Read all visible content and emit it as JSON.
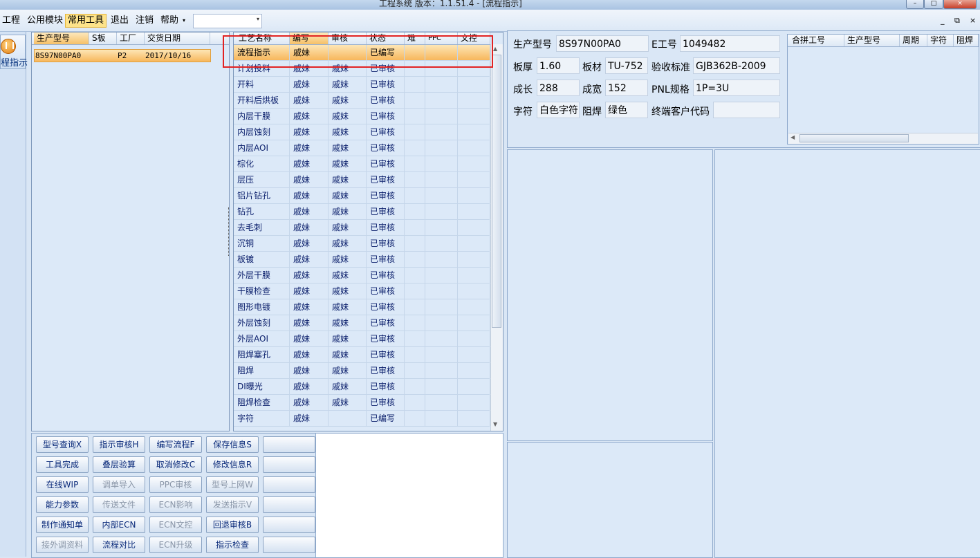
{
  "window": {
    "title": "工程系统   版本：1.1.51.4 - [流程指示]",
    "controls": [
      "–",
      "□",
      "×"
    ],
    "mdi_controls": [
      "_",
      "⧉",
      "×"
    ]
  },
  "menu": {
    "items": [
      "工程",
      "公用模块",
      "常用工具",
      "退出",
      "注销",
      "帮助"
    ],
    "active_index": 2,
    "help_arrow": "▾",
    "combo_arrow": "▾"
  },
  "sidebar": {
    "button_label": "程指示",
    "icon": "flow-indicator-icon"
  },
  "model_list": {
    "columns": [
      "生产型号",
      "S板",
      "工厂",
      "交货日期"
    ],
    "rows": [
      {
        "model": "8S97N00PA0",
        "s_board": "",
        "factory": "P2",
        "delivery_date": "2017/10/16"
      }
    ]
  },
  "process_grid": {
    "columns": [
      "工艺名称",
      "编写",
      "审核",
      "状态",
      "难",
      "PPC",
      "文控"
    ],
    "rows": [
      {
        "name": "流程指示",
        "writer": "戚妹",
        "reviewer": "",
        "status": "已编写"
      },
      {
        "name": "计划投料",
        "writer": "戚妹",
        "reviewer": "戚妹",
        "status": "已审核"
      },
      {
        "name": "开料",
        "writer": "戚妹",
        "reviewer": "戚妹",
        "status": "已审核"
      },
      {
        "name": "开料后烘板",
        "writer": "戚妹",
        "reviewer": "戚妹",
        "status": "已审核"
      },
      {
        "name": "内层干膜",
        "writer": "戚妹",
        "reviewer": "戚妹",
        "status": "已审核"
      },
      {
        "name": "内层蚀刻",
        "writer": "戚妹",
        "reviewer": "戚妹",
        "status": "已审核"
      },
      {
        "name": "内层AOI",
        "writer": "戚妹",
        "reviewer": "戚妹",
        "status": "已审核"
      },
      {
        "name": "棕化",
        "writer": "戚妹",
        "reviewer": "戚妹",
        "status": "已审核"
      },
      {
        "name": "层压",
        "writer": "戚妹",
        "reviewer": "戚妹",
        "status": "已审核"
      },
      {
        "name": "铝片钻孔",
        "writer": "戚妹",
        "reviewer": "戚妹",
        "status": "已审核"
      },
      {
        "name": "钻孔",
        "writer": "戚妹",
        "reviewer": "戚妹",
        "status": "已审核"
      },
      {
        "name": "去毛刺",
        "writer": "戚妹",
        "reviewer": "戚妹",
        "status": "已审核"
      },
      {
        "name": "沉铜",
        "writer": "戚妹",
        "reviewer": "戚妹",
        "status": "已审核"
      },
      {
        "name": "板镀",
        "writer": "戚妹",
        "reviewer": "戚妹",
        "status": "已审核"
      },
      {
        "name": "外层干膜",
        "writer": "戚妹",
        "reviewer": "戚妹",
        "status": "已审核"
      },
      {
        "name": "干膜检查",
        "writer": "戚妹",
        "reviewer": "戚妹",
        "status": "已审核"
      },
      {
        "name": "图形电镀",
        "writer": "戚妹",
        "reviewer": "戚妹",
        "status": "已审核"
      },
      {
        "name": "外层蚀刻",
        "writer": "戚妹",
        "reviewer": "戚妹",
        "status": "已审核"
      },
      {
        "name": "外层AOI",
        "writer": "戚妹",
        "reviewer": "戚妹",
        "status": "已审核"
      },
      {
        "name": "阻焊塞孔",
        "writer": "戚妹",
        "reviewer": "戚妹",
        "status": "已审核"
      },
      {
        "name": "阻焊",
        "writer": "戚妹",
        "reviewer": "戚妹",
        "status": "已审核"
      },
      {
        "name": "DI曝光",
        "writer": "戚妹",
        "reviewer": "戚妹",
        "status": "已审核"
      },
      {
        "name": "阻焊检查",
        "writer": "戚妹",
        "reviewer": "戚妹",
        "status": "已审核"
      },
      {
        "name": "字符",
        "writer": "戚妹",
        "reviewer": "",
        "status": "已编写"
      }
    ],
    "selected_index": 0
  },
  "buttons": [
    [
      {
        "label": "型号查询X",
        "enabled": true
      },
      {
        "label": "指示审核H",
        "enabled": true
      },
      {
        "label": "编写流程F",
        "enabled": true
      },
      {
        "label": "保存信息S",
        "enabled": true
      },
      {
        "label": "",
        "enabled": true
      }
    ],
    [
      {
        "label": "工具完成",
        "enabled": true
      },
      {
        "label": "叠层验算",
        "enabled": true
      },
      {
        "label": "取消修改C",
        "enabled": true
      },
      {
        "label": "修改信息R",
        "enabled": true
      },
      {
        "label": "",
        "enabled": true
      }
    ],
    [
      {
        "label": "在线WIP",
        "enabled": true
      },
      {
        "label": "调单导入",
        "enabled": false
      },
      {
        "label": "PPC审核",
        "enabled": false
      },
      {
        "label": "型号上网W",
        "enabled": false
      },
      {
        "label": "",
        "enabled": true
      }
    ],
    [
      {
        "label": "能力参数",
        "enabled": true
      },
      {
        "label": "传送文件",
        "enabled": false
      },
      {
        "label": "ECN影响",
        "enabled": false
      },
      {
        "label": "发送指示V",
        "enabled": false
      },
      {
        "label": "",
        "enabled": true
      }
    ],
    [
      {
        "label": "制作通知单",
        "enabled": true
      },
      {
        "label": "内部ECN",
        "enabled": true
      },
      {
        "label": "ECN文控",
        "enabled": false
      },
      {
        "label": "回退审核B",
        "enabled": true
      },
      {
        "label": "",
        "enabled": true
      }
    ],
    [
      {
        "label": "接外调资料",
        "enabled": false
      },
      {
        "label": "流程对比",
        "enabled": true
      },
      {
        "label": "ECN升级",
        "enabled": false
      },
      {
        "label": "指示检查",
        "enabled": true
      },
      {
        "label": "",
        "enabled": true
      }
    ]
  ],
  "info": {
    "model_label": "生产型号",
    "model_value": "8S97N00PA0",
    "ework_label": "E工号",
    "ework_value": "1049482",
    "thickness_label": "板厚",
    "thickness_value": "1.60",
    "material_label": "板材",
    "material_value": "TU-752",
    "standard_label": "验收标准",
    "standard_value": "GJB362B-2009",
    "length_label": "成长",
    "length_value": "288",
    "width_label": "成宽",
    "width_value": "152",
    "pnl_label": "PNL规格",
    "pnl_value": "1P=3U",
    "legend_label": "字符",
    "legend_value": "白色字符",
    "mask_label": "阻焊",
    "mask_value": "绿色",
    "customer_label": "终端客户代码",
    "customer_value": ""
  },
  "panel_grid": {
    "columns": [
      "合拼工号",
      "生产型号",
      "周期",
      "字符",
      "阻焊"
    ]
  }
}
